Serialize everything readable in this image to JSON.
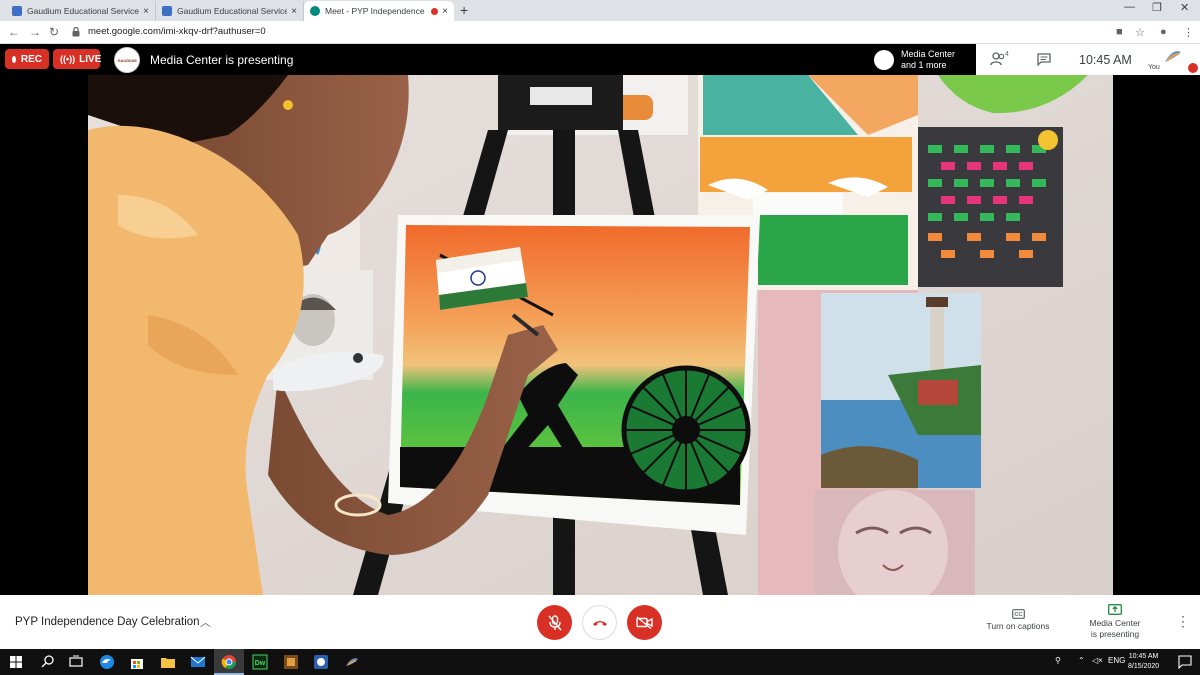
{
  "browser": {
    "tabs": [
      {
        "title": "Gaudium Educational Services Itr",
        "favicon": "gaudium-icon",
        "close": "×"
      },
      {
        "title": "Gaudium Educational Services Itr",
        "favicon": "gaudium-icon",
        "close": "×"
      },
      {
        "title": "Meet - PYP Independence D",
        "favicon": "meet-icon",
        "close": "×"
      }
    ],
    "new_tab": "+",
    "url": "meet.google.com/imi-xkqv-drf?authuser=0"
  },
  "meet": {
    "rec_label": "REC",
    "live_label": "LIVE",
    "presenting_title": "Media Center is presenting",
    "presenter_chip_line1": "Media Center",
    "presenter_chip_line2": "and 1 more",
    "people_count": "4",
    "clock": "10:45 AM",
    "you_label": "You",
    "logo_text": "GAUDIUM"
  },
  "bottom": {
    "meeting_title": "PYP Independence Day Celebration",
    "captions_label": "Turn on captions",
    "present_line1": "Media Center",
    "present_line2": "is presenting"
  },
  "taskbar": {
    "lang": "ENG",
    "time": "10:45 AM",
    "date": "8/15/2020"
  },
  "colors": {
    "accent_red": "#d93025",
    "meet_teal": "#00897b",
    "present_green": "#1e8e3e"
  }
}
